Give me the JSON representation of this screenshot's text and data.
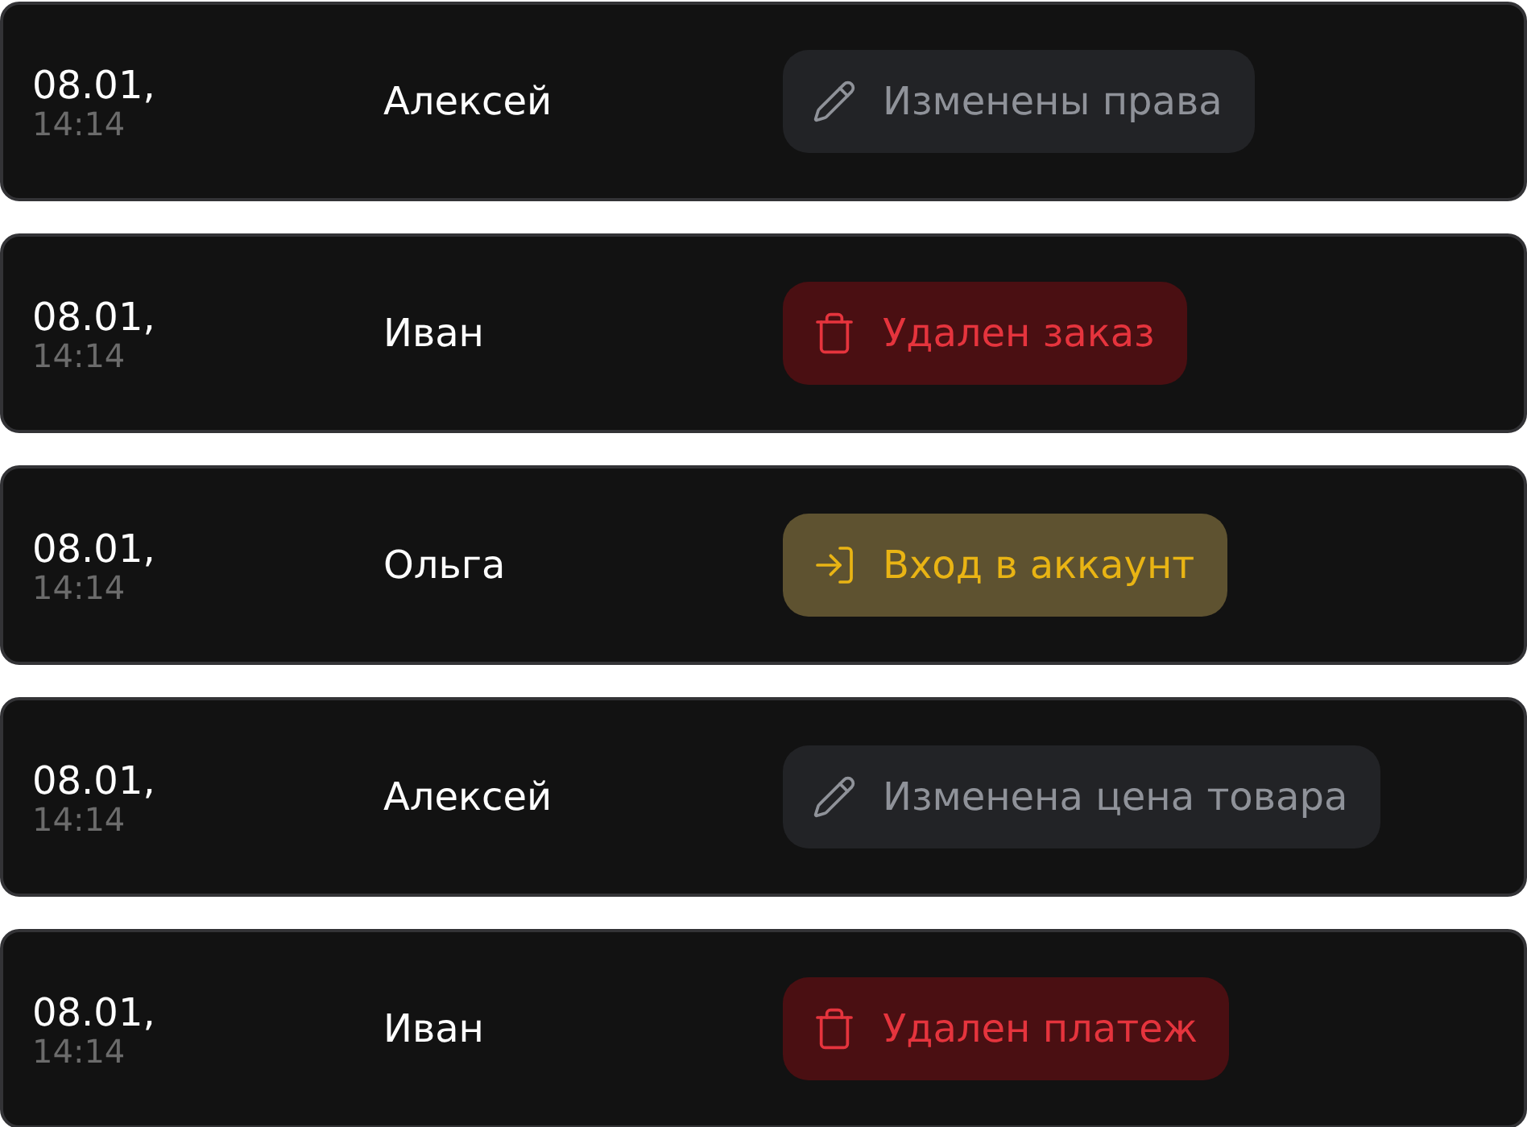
{
  "log": [
    {
      "date": "08.01,",
      "time": "14:14",
      "user": "Алексей",
      "action": {
        "kind": "edit",
        "label": "Изменены права"
      }
    },
    {
      "date": "08.01,",
      "time": "14:14",
      "user": "Иван",
      "action": {
        "kind": "delete",
        "label": "Удален заказ"
      }
    },
    {
      "date": "08.01,",
      "time": "14:14",
      "user": "Ольга",
      "action": {
        "kind": "login",
        "label": "Вход в аккаунт"
      }
    },
    {
      "date": "08.01,",
      "time": "14:14",
      "user": "Алексей",
      "action": {
        "kind": "edit",
        "label": "Изменена цена товара"
      }
    },
    {
      "date": "08.01,",
      "time": "14:14",
      "user": "Иван",
      "action": {
        "kind": "delete",
        "label": "Удален платеж"
      }
    }
  ]
}
